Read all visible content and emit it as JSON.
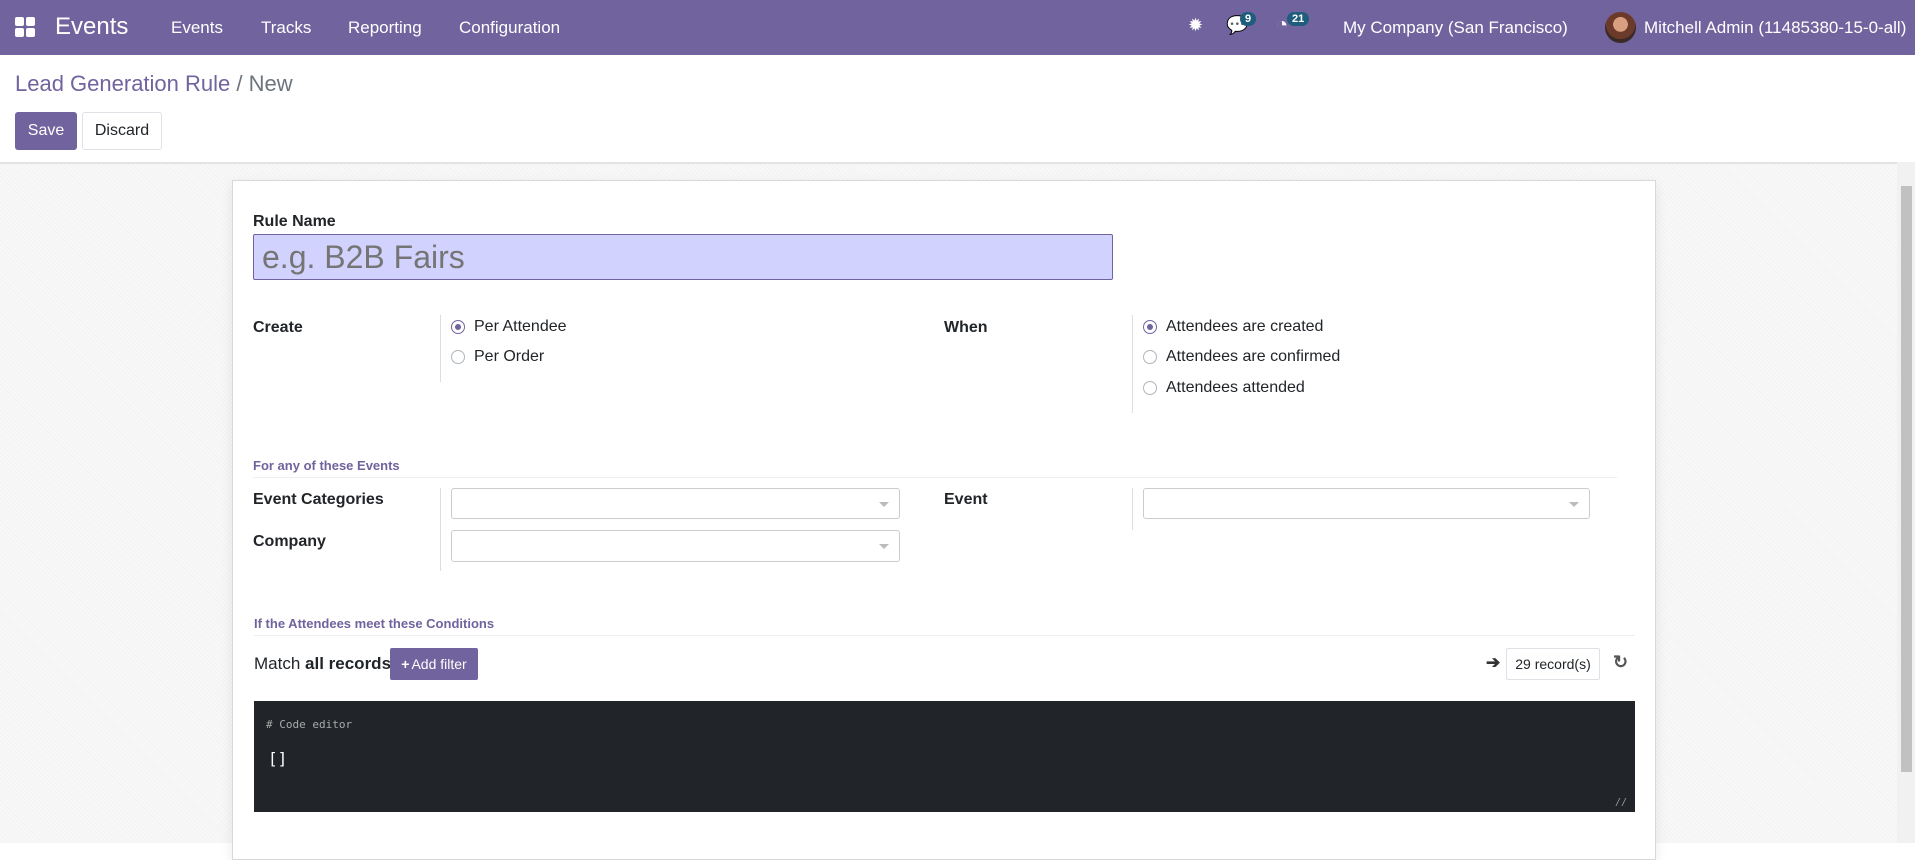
{
  "navbar": {
    "app_name": "Events",
    "menu": [
      "Events",
      "Tracks",
      "Reporting",
      "Configuration"
    ],
    "messages_count": "9",
    "activities_count": "21",
    "company": "My Company (San Francisco)",
    "user": "Mitchell Admin (11485380-15-0-all)"
  },
  "breadcrumb": {
    "parent": "Lead Generation Rule",
    "separator": "/",
    "current": "New"
  },
  "toolbar": {
    "save": "Save",
    "discard": "Discard"
  },
  "form": {
    "rule_name_label": "Rule Name",
    "rule_name_placeholder": "e.g. B2B Fairs",
    "rule_name_value": "",
    "create_label": "Create",
    "create_options": [
      "Per Attendee",
      "Per Order"
    ],
    "create_selected": "Per Attendee",
    "when_label": "When",
    "when_options": [
      "Attendees are created",
      "Attendees are confirmed",
      "Attendees attended"
    ],
    "when_selected": "Attendees are created",
    "events_section": "For any of these Events",
    "event_categories_label": "Event Categories",
    "company_label": "Company",
    "event_label": "Event",
    "conditions_section": "If the Attendees meet these Conditions",
    "match_prefix": "Match",
    "match_value": "all records",
    "add_filter": "Add filter",
    "records": "29 record(s)",
    "code_comment": "# Code editor",
    "code_value": "[]"
  },
  "colors": {
    "brand": "#71639e",
    "badge": "#1f5d7c",
    "editor_bg": "#212529"
  }
}
